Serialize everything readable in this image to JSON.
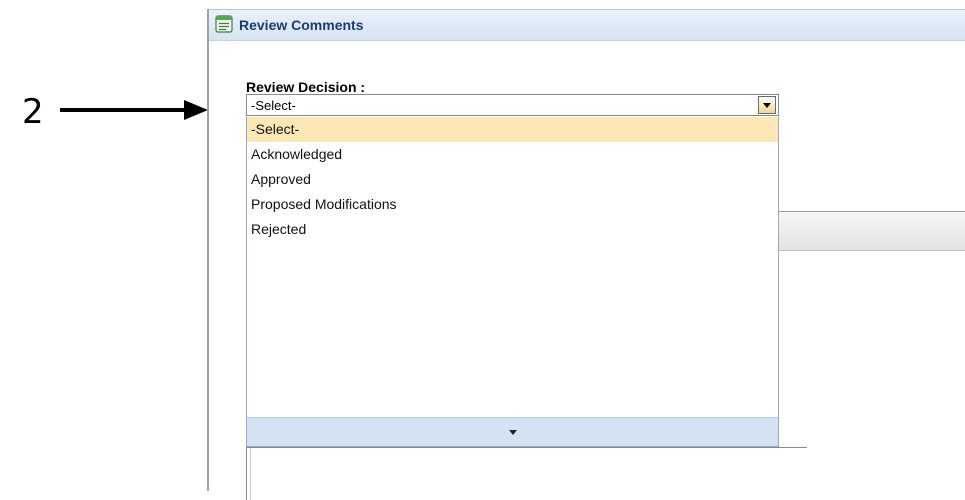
{
  "callout": {
    "number": "2"
  },
  "panel": {
    "title": "Review Comments",
    "icon": "comments-panel-icon"
  },
  "field": {
    "label": "Review Decision",
    "colon": " :"
  },
  "select": {
    "value": "-Select-",
    "options": [
      "-Select-",
      "Acknowledged",
      "Approved",
      "Proposed Modifications",
      "Rejected"
    ],
    "highlighted_index": 0
  },
  "colors": {
    "header_gradient_start": "#eaf1fa",
    "header_gradient_end": "#d6e3f2",
    "title_color": "#1c3a7a",
    "highlight": "#fde7b4",
    "dropdown_footer": "#d3e3f4"
  }
}
